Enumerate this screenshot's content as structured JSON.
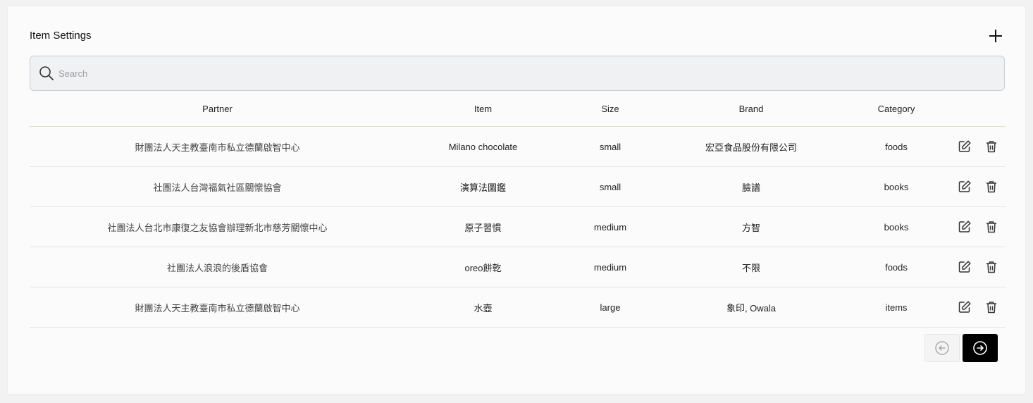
{
  "header": {
    "title": "Item Settings"
  },
  "search": {
    "placeholder": "Search",
    "value": ""
  },
  "table": {
    "columns": [
      "Partner",
      "Item",
      "Size",
      "Brand",
      "Category"
    ],
    "rows": [
      {
        "partner": "財團法人天主教臺南市私立德蘭啟智中心",
        "item": "Milano chocolate",
        "size": "small",
        "brand": "宏亞食品股份有限公司",
        "category": "foods"
      },
      {
        "partner": "社團法人台灣福氣社區關懷協會",
        "item": "演算法圖鑑",
        "size": "small",
        "brand": "臉譜",
        "category": "books"
      },
      {
        "partner": "社團法人台北市康復之友協會辦理新北市慈芳關懷中心",
        "item": "原子習慣",
        "size": "medium",
        "brand": "方智",
        "category": "books"
      },
      {
        "partner": "社團法人浪浪的後盾協會",
        "item": "oreo餅乾",
        "size": "medium",
        "brand": "不限",
        "category": "foods"
      },
      {
        "partner": "財團法人天主教臺南市私立德蘭啟智中心",
        "item": "水壺",
        "size": "large",
        "brand": "象印, Owala",
        "category": "items"
      }
    ]
  },
  "icons": {
    "add": "plus-icon",
    "search": "search-icon",
    "edit": "edit-icon",
    "delete": "trash-icon",
    "prev": "arrow-left-circle-icon",
    "next": "arrow-right-circle-icon"
  }
}
